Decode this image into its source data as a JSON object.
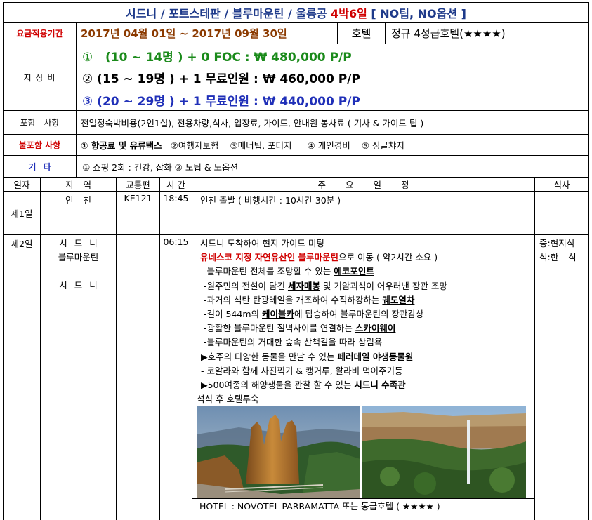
{
  "title": {
    "main": "시드니 / 포트스테판 / 블루마운틴 / 울릉공",
    "duration": "4박6일",
    "notes": "[ NO팁, NO옵션 ]"
  },
  "period": {
    "label": "요금적용기간",
    "value": "2017년 04월 01일 ~ 2017년 09월 30일",
    "hotel_label": "호텔",
    "hotel_value": "정규 4성급호텔(★★★★)"
  },
  "price": {
    "label": "지 상 비",
    "items": [
      {
        "num": "①",
        "text": "(10 ~ 14명 ) + 0 FOC : ₩ 480,000 P/P"
      },
      {
        "num": "②",
        "text": "(15 ~ 19명 ) + 1 무료인원 : ₩ 460,000 P/P"
      },
      {
        "num": "③",
        "text": "(20 ~ 29명 ) + 1 무료인원 : ₩ 440,000 P/P"
      }
    ]
  },
  "includes": {
    "label": "포함 사항",
    "value": "전일정숙박비용(2인1실), 전용차량,식사, 입장료, 가이드, 안내원 봉사료 ( 기사 & 가이드 팁 )"
  },
  "excludes": {
    "label": "불포함 사항",
    "items": [
      "① 항공료 및 유류택스",
      "②여행자보험",
      "③메너팁, 포터지",
      "④ 개인경비",
      "⑤ 싱글챠지"
    ]
  },
  "etc": {
    "label": "기 타",
    "value": "① 쇼핑 2회 : 건강, 잡화 ② 노팁 & 노옵션"
  },
  "schedule": {
    "headers": [
      "일자",
      "지 역",
      "교통편",
      "시 간",
      "주 요 일 정",
      "식사"
    ],
    "day1": {
      "day": "제1일",
      "region": "인 천",
      "transport": "KE121",
      "time": "18:45",
      "desc": "인천 출발 ( 비행시간 : 10시간 30분 )"
    },
    "day2": {
      "day": "제2일",
      "regions": [
        "시 드 니",
        "블루마운틴",
        "시 드 니"
      ],
      "time": "06:15",
      "meals": [
        "중:현지식",
        "석:한 식"
      ],
      "lines": [
        {
          "pre": "시드니 도착하여 현지 가이드 미팅",
          "hl": "",
          "post": ""
        },
        {
          "pre": "",
          "hl": "유네스코 지정 자연유산인 블루마운틴",
          "post": "으로 이동 ( 약2시간 소요 )"
        },
        {
          "pre": "-블루마운틴 전체를 조망할 수 있는 ",
          "hl": "에코포인트",
          "post": ""
        },
        {
          "pre": "-원주민의 전설이 담긴 ",
          "hl": "세자매봉",
          "post": " 및 기암괴석이 어우러낸 장관 조망"
        },
        {
          "pre": "-과거의 석탄 탄광레일을 개조하여 수직하강하는 ",
          "hl": "궤도열차",
          "post": ""
        },
        {
          "pre": "-길이 544m의 ",
          "hl": "케이블카",
          "post": "에 탑승하여 블루마운틴의 장관감상"
        },
        {
          "pre": "-광활한 블루마운틴 절벽사이를 연결하는 ",
          "hl": "스카이웨이",
          "post": ""
        },
        {
          "pre": "-블루마운틴의 거대한 숲속 산책길을 따라 삼림욕",
          "hl": "",
          "post": ""
        },
        {
          "pre": "▶호주의 다양한 동물을 만날 수 있는 ",
          "hl": "페러데일 야생동물원",
          "post": ""
        },
        {
          "pre": "- 코알라와 함께 사진찍기 & 캥거루, 왈라비 먹이주기등",
          "hl": "",
          "post": ""
        },
        {
          "pre": "▶500여종의 해양생물을 관찰 할 수 있는 ",
          "hl": "시드니 수족관",
          "post": ""
        },
        {
          "pre": "석식 후 호텔투숙",
          "hl": "",
          "post": ""
        }
      ],
      "hotel": "HOTEL : NOVOTEL PARRAMATTA 또는 동급호텔 ( ★★★★ )"
    }
  },
  "colors": {
    "navy": "#1e3a8a",
    "red": "#d00000",
    "brown": "#8b3a00",
    "green": "#1a8a1a",
    "blue": "#1f2fb8"
  }
}
